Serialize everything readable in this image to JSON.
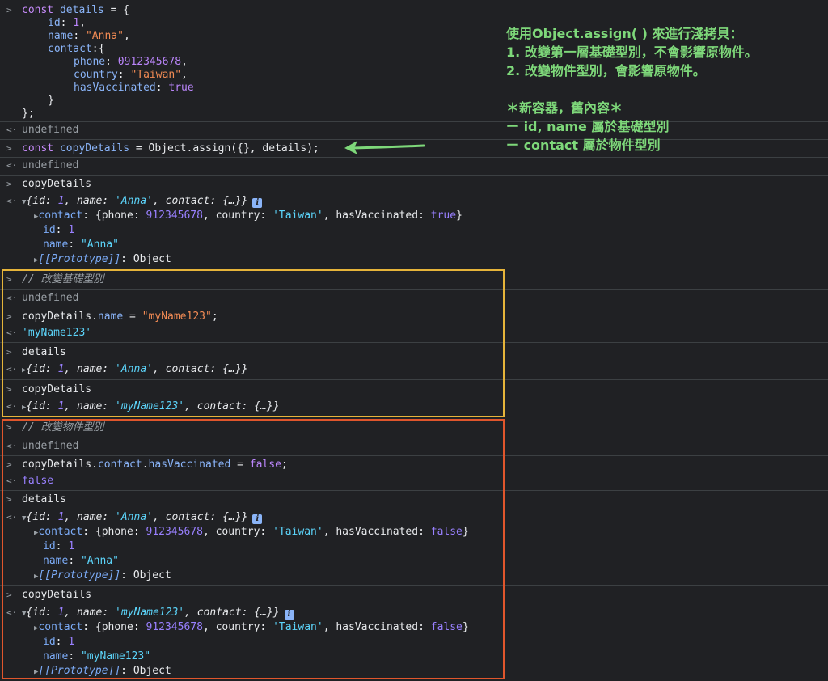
{
  "console": {
    "prompt_icon": "chevron-right-icon",
    "return_icon": "return-arrow-icon",
    "block1": {
      "l1a": "const ",
      "l1b": "details",
      "l1c": " = {",
      "l2k": "id",
      "l2v": "1",
      "l3k": "name",
      "l3v": "\"Anna\"",
      "l4k": "contact",
      "l5k": "phone",
      "l5v": "0912345678",
      "l6k": "country",
      "l6v": "\"Taiwan\"",
      "l7k": "hasVaccinated",
      "l7v": "true",
      "l8": "}",
      "l9": "};"
    },
    "undefined": "undefined",
    "block2": {
      "a": "const ",
      "b": "copyDetails",
      "c": " = Object.assign({}, details);"
    },
    "copyDetails": "copyDetails",
    "details": "details",
    "obj1": {
      "summary_id_v": "1",
      "summary_name_v": "'Anna'",
      "summary_contact": "{…}",
      "contact_phone": "912345678",
      "contact_country": "'Taiwan'",
      "contact_vacc": "true",
      "id": "1",
      "name": "\"Anna\"",
      "proto": "[[Prototype]]",
      "proto_v": "Object"
    },
    "comment1": "// 改變基礎型別",
    "assign_name": {
      "a": "copyDetails.",
      "b": "name",
      "c": " = ",
      "d": "\"myName123\"",
      "e": ";"
    },
    "result_name": "'myName123'",
    "sum_details_name": "'Anna'",
    "sum_copy_name": "'myName123'",
    "comment2": "// 改變物件型別",
    "assign_contact": {
      "a": "copyDetails.",
      "b": "contact",
      "c": ".",
      "d": "hasVaccinated",
      "e": " = ",
      "f": "false",
      "g": ";"
    },
    "result_false": "false",
    "obj2": {
      "vacc": "false",
      "name": "\"Anna\""
    },
    "obj3": {
      "name_sum": "'myName123'",
      "vacc": "false",
      "name": "\"myName123\""
    },
    "labels": {
      "id": "id",
      "name": "name",
      "contact": "contact",
      "phone": "phone",
      "country": "country",
      "hasVaccinated": "hasVaccinated"
    }
  },
  "annotation": {
    "line1": "使用Object.assign( ) 來進行淺拷貝：",
    "line2": "1. 改變第一層基礎型別，不會影響原物件。",
    "line3": "2. 改變物件型別，會影響原物件。",
    "line4": "",
    "line5": "＊新容器，舊內容＊",
    "line6": "ー id, name 屬於基礎型別",
    "line7": "ー contact 屬於物件型別"
  },
  "colors": {
    "yellow_box": "#e6b43a",
    "orange_box": "#e0562c",
    "annotation": "#7ed87a"
  }
}
